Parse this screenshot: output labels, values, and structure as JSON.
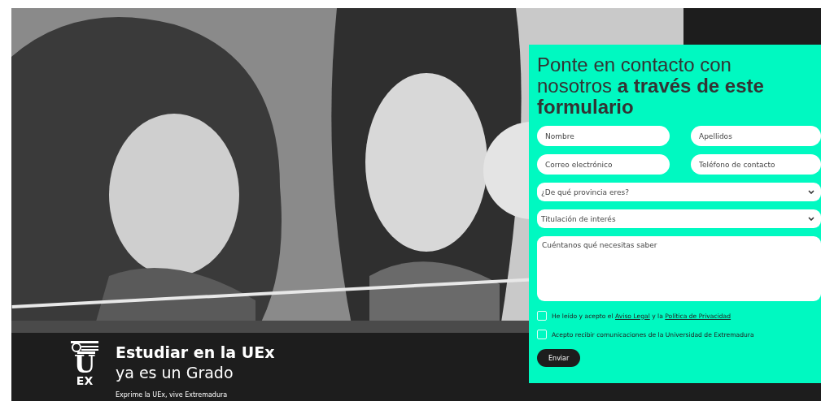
{
  "hero": {
    "title_line1": "Estudiar en la UEx",
    "title_line2": "ya es un Grado",
    "tagline": "Exprime la UEx, vive Extremadura",
    "logo_letter": "U",
    "logo_letters": "EX"
  },
  "form": {
    "heading": "Ponte en contacto con nosotros **a través de este formulario**",
    "fields": [
      {
        "kind": "input",
        "placeholder": "Nombre"
      },
      {
        "kind": "input",
        "placeholder": "Apellidos"
      },
      {
        "kind": "input",
        "placeholder": "Correo electrónico"
      },
      {
        "kind": "input",
        "placeholder": "Teléfono de contacto"
      },
      {
        "kind": "select",
        "placeholder": "¿De qué provincia eres?"
      },
      {
        "kind": "select",
        "placeholder": "Titulación de interés"
      },
      {
        "kind": "textarea",
        "placeholder": "Cuéntanos qué necesitas saber"
      }
    ],
    "consents": [
      {
        "checked": false,
        "segments": [
          {
            "text": "He leído y acepto el ",
            "link": false
          },
          {
            "text": "Aviso Legal",
            "link": true
          },
          {
            "text": " y la ",
            "link": false
          },
          {
            "text": "Política de Privacidad",
            "link": true
          }
        ]
      },
      {
        "checked": false,
        "segments": [
          {
            "text": "Acepto recibir comunicaciones de la Universidad de Extremadura",
            "link": false
          }
        ]
      }
    ],
    "submit": "Enviar"
  }
}
